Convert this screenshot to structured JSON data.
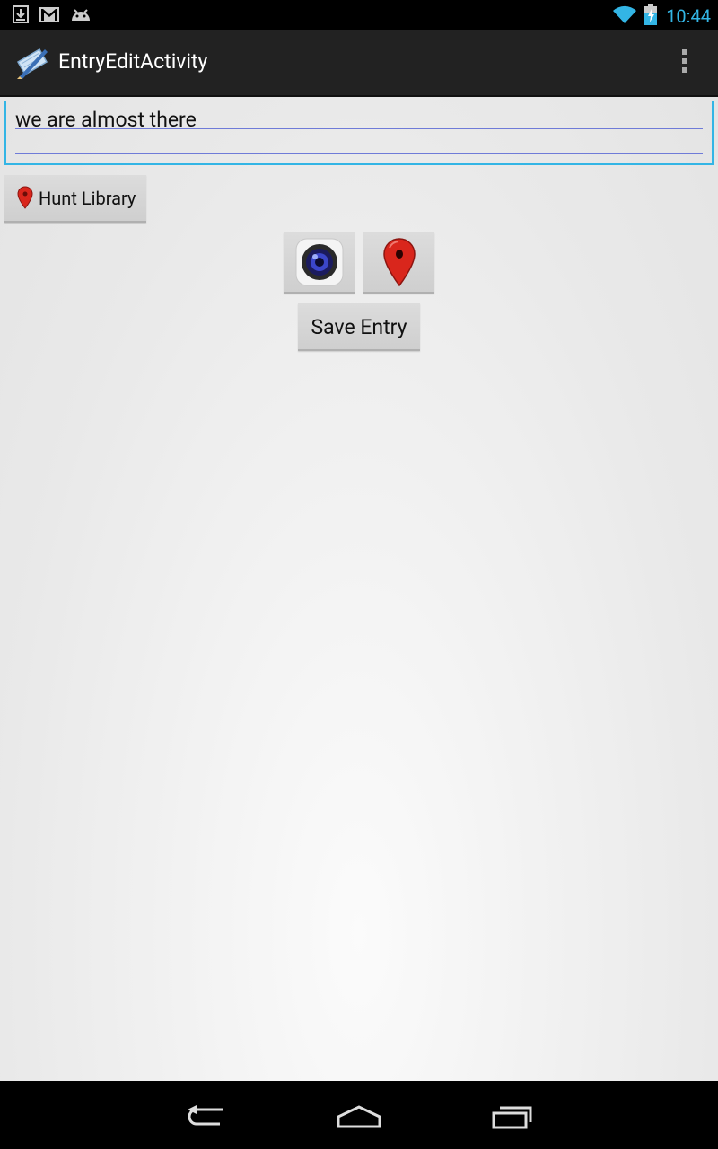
{
  "status_bar": {
    "left_icons": [
      "download-icon",
      "gmail-icon",
      "android-icon"
    ],
    "right_icons": [
      "wifi-icon",
      "battery-charging-icon"
    ],
    "time": "10:44"
  },
  "action_bar": {
    "app_icon": "app-logo-icon",
    "title": "EntryEditActivity",
    "overflow_icon": "overflow-menu-icon"
  },
  "entry": {
    "text": "we are almost there"
  },
  "location_button": {
    "icon": "map-pin-icon",
    "label": "Hunt Library"
  },
  "media_buttons": [
    {
      "icon": "camera-icon"
    },
    {
      "icon": "map-marker-icon"
    }
  ],
  "save_button": {
    "label": "Save Entry"
  },
  "nav_bar": {
    "buttons": [
      "back-icon",
      "home-icon",
      "recent-apps-icon"
    ]
  },
  "colors": {
    "accent": "#33b5e5",
    "action_bar": "#222222",
    "pin_red": "#d9261c"
  }
}
